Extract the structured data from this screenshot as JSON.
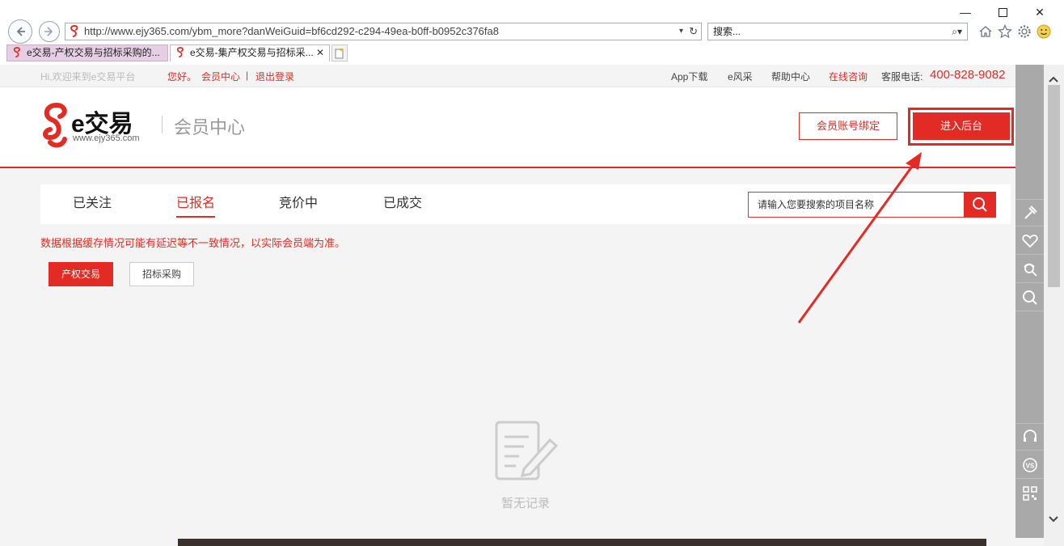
{
  "browser": {
    "url": "http://www.ejy365.com/ybm_more?danWeiGuid=bf6cd292-c294-49ea-b0ff-b0952c376fa8",
    "search_placeholder": "搜索...",
    "tabs": [
      {
        "label": "e交易-产权交易与招标采购的..."
      },
      {
        "label": "e交易-集产权交易与招标采..."
      }
    ],
    "close_tab_glyph": "✕"
  },
  "topbar": {
    "welcome": "Hi,欢迎来到e交易平台",
    "hello": "您好。",
    "member_center": "会员中心",
    "separator": "|",
    "logout": "退出登录",
    "app_download": "App下载",
    "e_fengcai": "e风采",
    "help_center": "帮助中心",
    "online_consult": "在线咨询",
    "phone_label": "客服电话:",
    "phone_number": "400-828-9082"
  },
  "header": {
    "logo_text": "e交易",
    "logo_url": "www.ejy365.com",
    "section_title": "会员中心",
    "bind_button": "会员账号绑定",
    "enter_backend_button": "进入后台"
  },
  "tabs": [
    {
      "label": "已关注"
    },
    {
      "label": "已报名"
    },
    {
      "label": "竞价中"
    },
    {
      "label": "已成交"
    }
  ],
  "search": {
    "placeholder": "请输入您要搜索的项目名称"
  },
  "notice": "数据根据缓存情况可能有延迟等不一致情况，以实际会员端为准。",
  "filters": [
    {
      "label": "产权交易"
    },
    {
      "label": "招标采购"
    }
  ],
  "empty_state": {
    "text": "暂无记录",
    "icon": "document-edit-icon"
  },
  "colors": {
    "brand_red": "#e22b25",
    "page_bg": "#f4f4f4"
  }
}
